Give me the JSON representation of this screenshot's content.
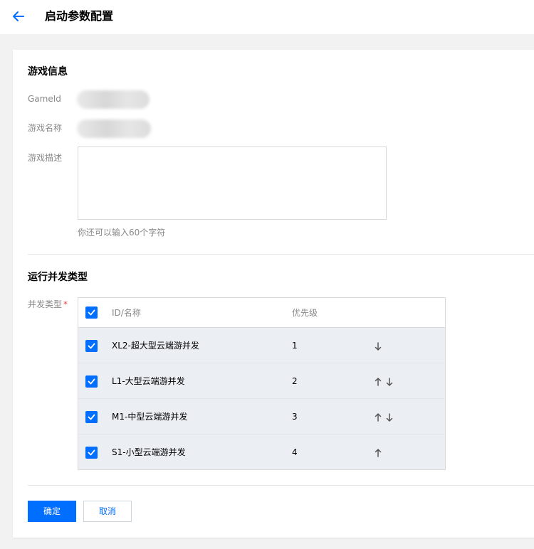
{
  "header": {
    "title": "启动参数配置"
  },
  "game_info": {
    "section_title": "游戏信息",
    "game_id_label": "GameId",
    "game_name_label": "游戏名称",
    "description_label": "游戏描述",
    "description_value": "",
    "description_hint": "你还可以输入60个字符"
  },
  "concurrency": {
    "section_title": "运行并发类型",
    "field_label": "并发类型",
    "required_mark": "*",
    "columns": {
      "id_name": "ID/名称",
      "priority": "优先级"
    },
    "rows": [
      {
        "name": "XL2-超大型云端游并发",
        "priority": "1",
        "checked": true,
        "up": false,
        "down": true
      },
      {
        "name": "L1-大型云端游并发",
        "priority": "2",
        "checked": true,
        "up": true,
        "down": true
      },
      {
        "name": "M1-中型云端游并发",
        "priority": "3",
        "checked": true,
        "up": true,
        "down": true
      },
      {
        "name": "S1-小型云端游并发",
        "priority": "4",
        "checked": true,
        "up": true,
        "down": false
      }
    ]
  },
  "actions": {
    "confirm_label": "确定",
    "cancel_label": "取消"
  },
  "colors": {
    "accent": "#006eff",
    "row_bg": "#ebeef3",
    "required": "#e54545"
  }
}
